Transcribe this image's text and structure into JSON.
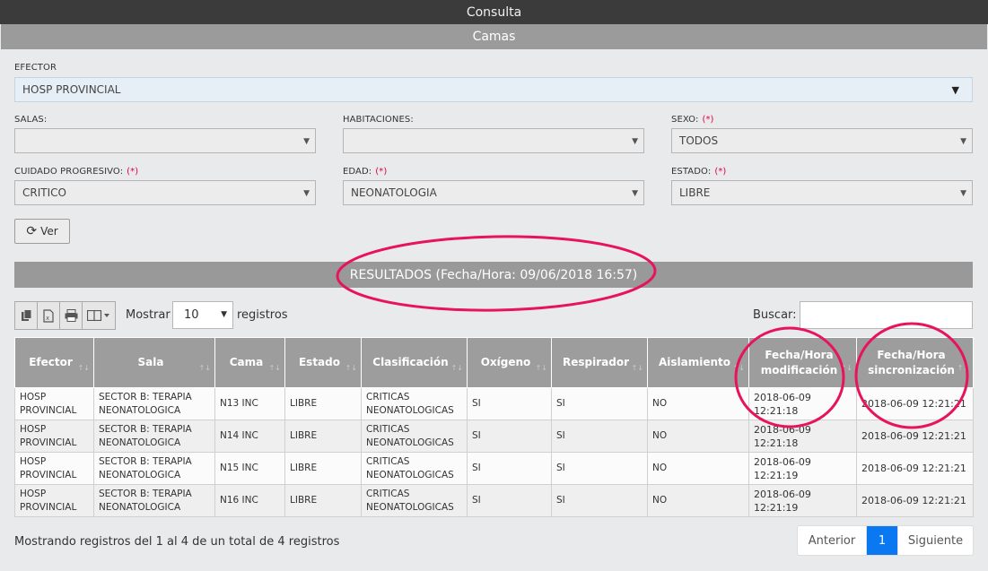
{
  "header": {
    "title": "Consulta",
    "subtitle": "Camas"
  },
  "form": {
    "efector": {
      "label": "EFECTOR",
      "value": "HOSP PROVINCIAL"
    },
    "salas": {
      "label": "SALAS:",
      "value": ""
    },
    "habitaciones": {
      "label": "HABITACIONES:",
      "value": ""
    },
    "sexo": {
      "label": "SEXO:",
      "required": "(*)",
      "value": "TODOS"
    },
    "cuidado": {
      "label": "CUIDADO PROGRESIVO:",
      "required": "(*)",
      "value": "CRITICO"
    },
    "edad": {
      "label": "EDAD:",
      "required": "(*)",
      "value": "NEONATOLOGIA"
    },
    "estado": {
      "label": "ESTADO:",
      "required": "(*)",
      "value": "LIBRE"
    },
    "ver_label": "Ver"
  },
  "results": {
    "title": "RESULTADOS (Fecha/Hora: 09/06/2018 16:57)"
  },
  "table_controls": {
    "mostrar": "Mostrar",
    "page_length": "10",
    "registros": "registros",
    "buscar": "Buscar:",
    "toolbar_icons": [
      "copy-icon",
      "excel-icon",
      "print-icon",
      "columns-icon"
    ]
  },
  "table": {
    "headers": [
      "Efector",
      "Sala",
      "Cama",
      "Estado",
      "Clasificación",
      "Oxígeno",
      "Respirador",
      "Aislamiento",
      "Fecha/Hora modificación",
      "Fecha/Hora sincronización"
    ],
    "rows": [
      [
        "HOSP PROVINCIAL",
        "SECTOR B: TERAPIA NEONATOLOGICA",
        "N13 INC",
        "LIBRE",
        "CRITICAS NEONATOLOGICAS",
        "SI",
        "SI",
        "NO",
        "2018-06-09 12:21:18",
        "2018-06-09 12:21:21"
      ],
      [
        "HOSP PROVINCIAL",
        "SECTOR B: TERAPIA NEONATOLOGICA",
        "N14 INC",
        "LIBRE",
        "CRITICAS NEONATOLOGICAS",
        "SI",
        "SI",
        "NO",
        "2018-06-09 12:21:18",
        "2018-06-09 12:21:21"
      ],
      [
        "HOSP PROVINCIAL",
        "SECTOR B: TERAPIA NEONATOLOGICA",
        "N15 INC",
        "LIBRE",
        "CRITICAS NEONATOLOGICAS",
        "SI",
        "SI",
        "NO",
        "2018-06-09 12:21:19",
        "2018-06-09 12:21:21"
      ],
      [
        "HOSP PROVINCIAL",
        "SECTOR B: TERAPIA NEONATOLOGICA",
        "N16 INC",
        "LIBRE",
        "CRITICAS NEONATOLOGICAS",
        "SI",
        "SI",
        "NO",
        "2018-06-09 12:21:19",
        "2018-06-09 12:21:21"
      ]
    ]
  },
  "footer": {
    "info": "Mostrando registros del 1 al 4 de un total de 4 registros",
    "prev": "Anterior",
    "page": "1",
    "next": "Siguiente"
  },
  "colors": {
    "accent": "#0a78f0",
    "annotation": "#e8135d",
    "header_bg": "#3b3b3b",
    "subheader_bg": "#9b9b9b"
  }
}
